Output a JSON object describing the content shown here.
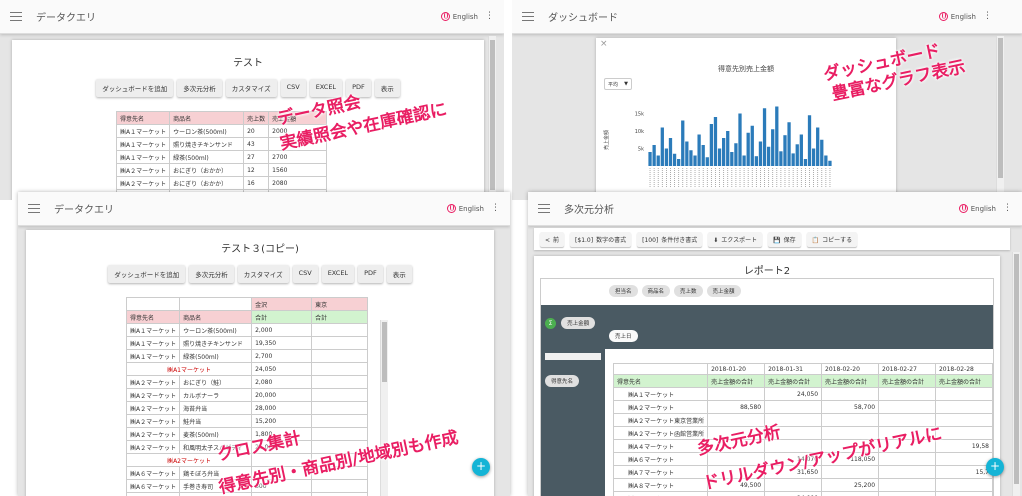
{
  "panel1": {
    "title": "データクエリ",
    "lang": "English",
    "doc_title": "テスト",
    "buttons": [
      "ダッシュボードを追加",
      "多次元分析",
      "カスタマイズ",
      "CSV",
      "EXCEL",
      "PDF",
      "表示"
    ],
    "columns": [
      "得意先名",
      "商品名",
      "売上数",
      "売上金額"
    ],
    "rows": [
      [
        "㈱A１マーケット",
        "ウーロン茶(500ml)",
        "20",
        "2000"
      ],
      [
        "㈱A１マーケット",
        "照り焼きチキンサンド",
        "43",
        ""
      ],
      [
        "㈱A１マーケット",
        "緑茶(500ml)",
        "27",
        "2700"
      ],
      [
        "㈱A２マーケット",
        "おにぎり（おかか）",
        "12",
        "1560"
      ],
      [
        "㈱A２マーケット",
        "おにぎり（おかか）",
        "16",
        "2080"
      ],
      [
        "㈱A２マーケット",
        "おにぎり（おかか）",
        "20",
        "2600"
      ]
    ],
    "overlay_line1": "データ照会",
    "overlay_line2": "実績照会や在庫確認に"
  },
  "panel2": {
    "title": "ダッシュボード",
    "lang": "English",
    "chart_title": "得意先別売上金額",
    "select_value": "平均",
    "overlay_line1": "ダッシュボード",
    "overlay_line2": "豊富なグラフ表示",
    "chart_data": {
      "type": "bar",
      "title": "得意先別売上金額",
      "ylabel": "売上金額",
      "yticks": [
        "15k",
        "10k",
        "5k"
      ],
      "ylim": [
        0,
        20000
      ],
      "values": [
        4000,
        6000,
        3000,
        11000,
        5000,
        8000,
        3500,
        2000,
        13000,
        7000,
        4500,
        3000,
        9000,
        6000,
        2500,
        12000,
        14000,
        5000,
        8000,
        10000,
        4000,
        6500,
        15000,
        3000,
        9500,
        11500,
        2800,
        7000,
        16500,
        5500,
        10500,
        17000,
        4200,
        8800,
        12500,
        3600,
        6200,
        9000,
        2000,
        14500,
        5000,
        11000,
        7500,
        3000,
        1500
      ]
    }
  },
  "panel3": {
    "title": "データクエリ",
    "lang": "English",
    "doc_title": "テスト３(コピー)",
    "buttons": [
      "ダッシュボードを追加",
      "多次元分析",
      "カスタマイズ",
      "CSV",
      "EXCEL",
      "PDF",
      "表示"
    ],
    "region_headers": [
      "金沢",
      "東京"
    ],
    "columns": [
      "得意先名",
      "商品名",
      "合計",
      "合計"
    ],
    "rows": [
      {
        "c": "㈱A１マーケット",
        "p": "ウーロン茶(500ml)",
        "v1": "2,000",
        "v2": ""
      },
      {
        "c": "㈱A１マーケット",
        "p": "照り焼きチキンサンド",
        "v1": "19,350",
        "v2": ""
      },
      {
        "c": "㈱A１マーケット",
        "p": "緑茶(500ml)",
        "v1": "2,700",
        "v2": ""
      },
      {
        "sub": "㈱A1マーケット",
        "v1": "24,050",
        "v2": ""
      },
      {
        "c": "㈱A２マーケット",
        "p": "おにぎり（鮭）",
        "v1": "2,080",
        "v2": ""
      },
      {
        "c": "㈱A２マーケット",
        "p": "カルボナーラ",
        "v1": "20,000",
        "v2": ""
      },
      {
        "c": "㈱A２マーケット",
        "p": "海苔弁当",
        "v1": "28,000",
        "v2": ""
      },
      {
        "c": "㈱A２マーケット",
        "p": "鮭弁当",
        "v1": "15,200",
        "v2": ""
      },
      {
        "c": "㈱A２マーケット",
        "p": "麦茶(500ml)",
        "v1": "1,800",
        "v2": ""
      },
      {
        "c": "㈱A２マーケット",
        "p": "和風明太子スパゲティ",
        "v1": "21,000",
        "v2": ""
      },
      {
        "sub": "㈱A2マーケット",
        "v1": "",
        "v2": ""
      },
      {
        "c": "㈱A６マーケット",
        "p": "鶏そぼろ弁当",
        "v1": "",
        "v2": ""
      },
      {
        "c": "㈱A６マーケット",
        "p": "手巻き寿司",
        "v1": "300",
        "v2": ""
      },
      {
        "c": "㈱A６マーケット",
        "p": "手巻き寿司（鮭）",
        "v1": "2,400",
        "v2": ""
      },
      {
        "c": "㈱A６マーケット",
        "p": "焼肉弁当",
        "v1": "23,800",
        "v2": ""
      }
    ],
    "overlay_line1": "クロス集計",
    "overlay_line2": "得意先別・商品別/地域別も作成",
    "fab": "+"
  },
  "panel4": {
    "title": "多次元分析",
    "lang": "English",
    "toolbar": [
      "前",
      "数字の書式",
      "条件付き書式",
      "エクスポート",
      "保存",
      "コピーする"
    ],
    "toolbar_prefix": [
      "<",
      "[$1.0]",
      "[100]",
      "⬇",
      "💾",
      "📋"
    ],
    "report_title": "レポート2",
    "filter_chips": [
      "担当名",
      "商品名",
      "売上数",
      "売上金額"
    ],
    "value_chip": "売上金額",
    "row_chip": "売上日",
    "col_chip": "得意先名",
    "date_headers": [
      "2018-01-20",
      "2018-01-31",
      "2018-02-20",
      "2018-02-27",
      "2018-02-28"
    ],
    "measure_header": "売上金額の合計",
    "first_header": "得意先名",
    "rows": [
      {
        "n": "㈱A１マーケット",
        "v": [
          "",
          "24,050",
          "",
          "",
          ""
        ]
      },
      {
        "n": "㈱A２マーケット",
        "v": [
          "88,580",
          "",
          "58,700",
          "",
          ""
        ]
      },
      {
        "n": "㈱A２マーケット東京営業所",
        "v": [
          "",
          "",
          "",
          "",
          ""
        ]
      },
      {
        "n": "㈱A２マーケット函館営業所",
        "v": [
          "",
          "",
          "",
          "",
          ""
        ]
      },
      {
        "n": "㈱A４マーケット",
        "v": [
          "",
          "",
          "",
          "",
          "19,58"
        ]
      },
      {
        "n": "㈱A６マーケット",
        "v": [
          "",
          "14,070",
          "118,050",
          "",
          ""
        ]
      },
      {
        "n": "㈱A７マーケット",
        "v": [
          "",
          "31,650",
          "",
          "",
          "15,7"
        ]
      },
      {
        "n": "㈱A８マーケット",
        "v": [
          "49,500",
          "",
          "25,200",
          "",
          ""
        ]
      },
      {
        "n": "㈱A９マーケット",
        "v": [
          "",
          "24,000",
          "",
          "",
          ""
        ]
      }
    ],
    "overlay_line1": "多次元分析",
    "overlay_line2": "ドリルダウン/アップがリアルに",
    "fab": "+"
  }
}
